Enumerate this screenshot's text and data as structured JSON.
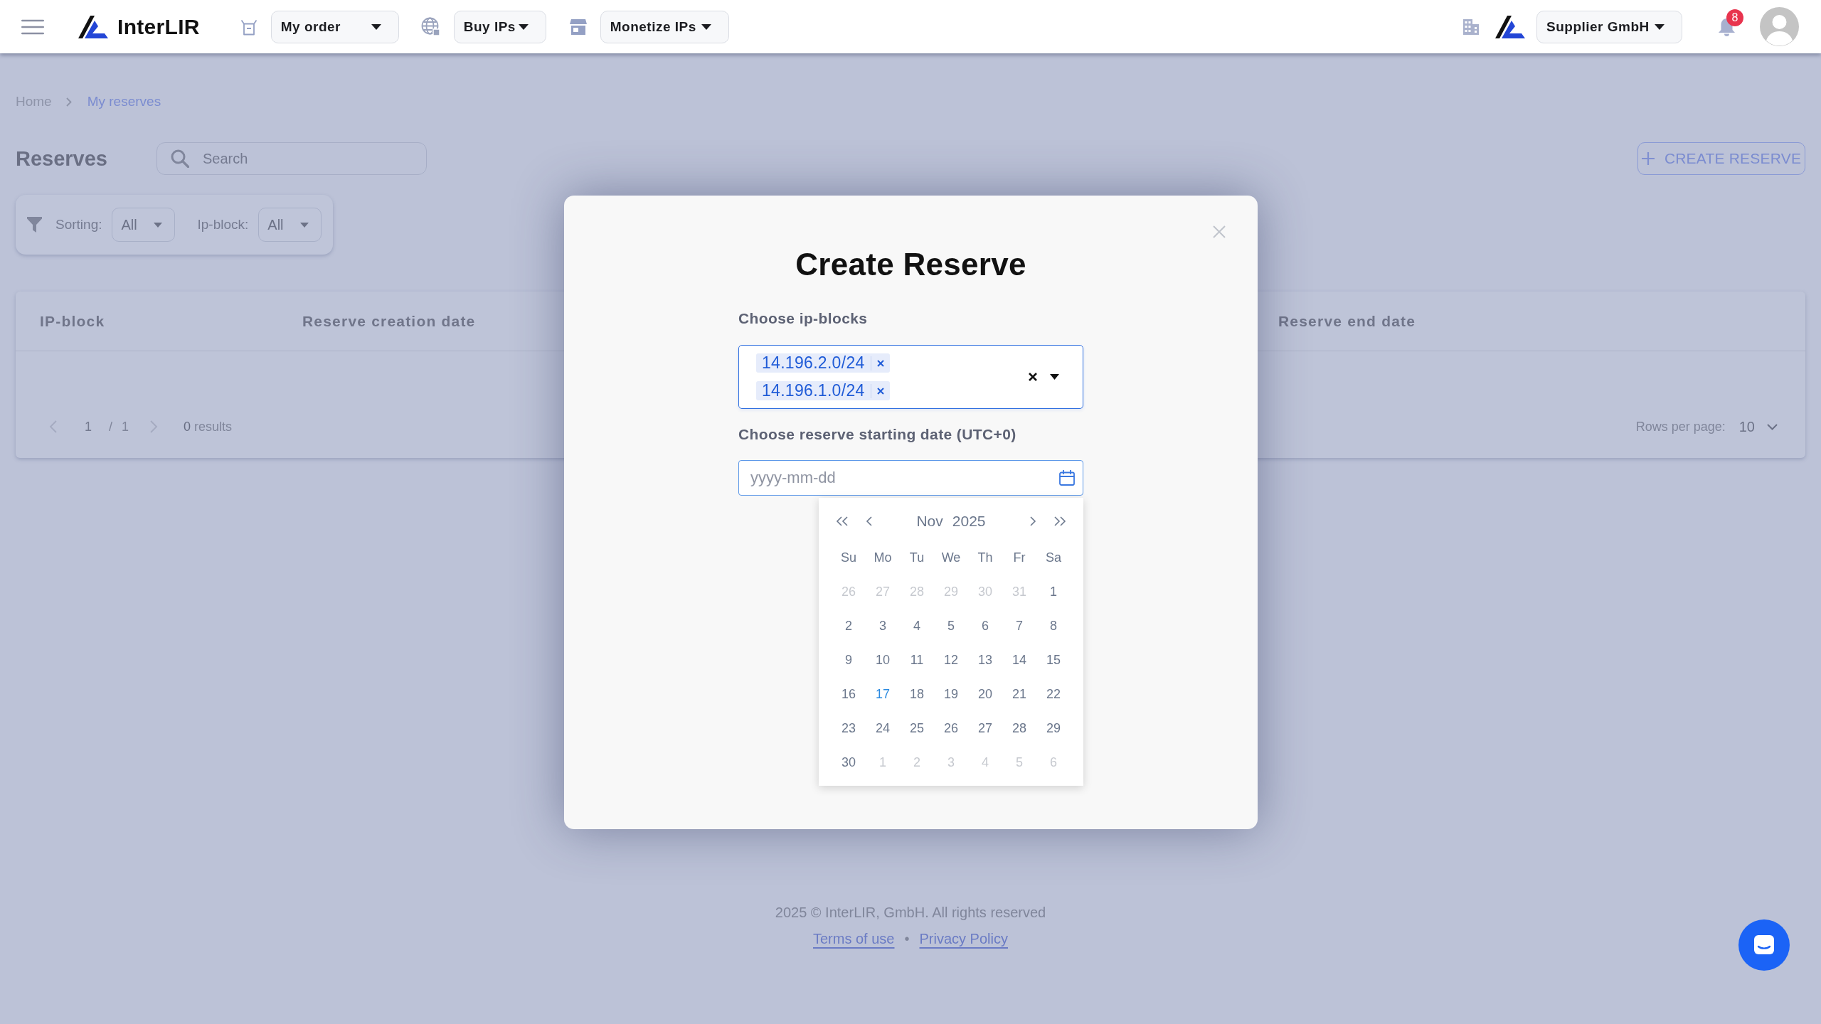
{
  "top_bar": {
    "brand": "InterLIR",
    "nav": [
      {
        "label": "My order"
      },
      {
        "label": "Buy IPs"
      },
      {
        "label": "Monetize IPs"
      }
    ],
    "account": "Supplier GmbH",
    "notification_count": "8"
  },
  "breadcrumb": [
    {
      "label": "Home",
      "current": false
    },
    {
      "label": "My reserves",
      "current": true
    }
  ],
  "page_title": "Reserves",
  "search": {
    "placeholder": "Search"
  },
  "create_button": "CREATE RESERVE",
  "filters": [
    {
      "label": "Sorting:",
      "value": "All"
    },
    {
      "label": "Ip-block:",
      "value": "All"
    }
  ],
  "table": {
    "columns": [
      "IP-block",
      "Reserve creation date",
      "Reserve end date"
    ],
    "pagination": {
      "prev_disabled": true,
      "page": "1",
      "separator": "/",
      "total": "1",
      "next_disabled": true,
      "results": "**0** results"
    },
    "rows_per_page": {
      "label": "Rows per page:",
      "value": "10"
    }
  },
  "modal": {
    "title": "Create Reserve",
    "ip_blocks": {
      "label": "Choose ip-blocks",
      "tags": [
        "14.196.2.0/24",
        "14.196.1.0/24"
      ]
    },
    "start_date": {
      "label": "Choose reserve starting date (UTC+0)",
      "placeholder": "yyyy-mm-dd"
    },
    "calendar": {
      "month": "Nov",
      "year": "2025",
      "weekdays": [
        "Su",
        "Mo",
        "Tu",
        "We",
        "Th",
        "Fr",
        "Sa"
      ],
      "weeks": [
        [
          {
            "day": "26",
            "outside": true,
            "today": false
          },
          {
            "day": "27",
            "outside": true,
            "today": false
          },
          {
            "day": "28",
            "outside": true,
            "today": false
          },
          {
            "day": "29",
            "outside": true,
            "today": false
          },
          {
            "day": "30",
            "outside": true,
            "today": false
          },
          {
            "day": "31",
            "outside": true,
            "today": false
          },
          {
            "day": "1",
            "outside": false,
            "today": false
          }
        ],
        [
          {
            "day": "2",
            "outside": false,
            "today": false
          },
          {
            "day": "3",
            "outside": false,
            "today": false
          },
          {
            "day": "4",
            "outside": false,
            "today": false
          },
          {
            "day": "5",
            "outside": false,
            "today": false
          },
          {
            "day": "6",
            "outside": false,
            "today": false
          },
          {
            "day": "7",
            "outside": false,
            "today": false
          },
          {
            "day": "8",
            "outside": false,
            "today": false
          }
        ],
        [
          {
            "day": "9",
            "outside": false,
            "today": false
          },
          {
            "day": "10",
            "outside": false,
            "today": false
          },
          {
            "day": "11",
            "outside": false,
            "today": false
          },
          {
            "day": "12",
            "outside": false,
            "today": false
          },
          {
            "day": "13",
            "outside": false,
            "today": false
          },
          {
            "day": "14",
            "outside": false,
            "today": false
          },
          {
            "day": "15",
            "outside": false,
            "today": false
          }
        ],
        [
          {
            "day": "16",
            "outside": false,
            "today": false
          },
          {
            "day": "17",
            "outside": false,
            "today": true
          },
          {
            "day": "18",
            "outside": false,
            "today": false
          },
          {
            "day": "19",
            "outside": false,
            "today": false
          },
          {
            "day": "20",
            "outside": false,
            "today": false
          },
          {
            "day": "21",
            "outside": false,
            "today": false
          },
          {
            "day": "22",
            "outside": false,
            "today": false
          }
        ],
        [
          {
            "day": "23",
            "outside": false,
            "today": false
          },
          {
            "day": "24",
            "outside": false,
            "today": false
          },
          {
            "day": "25",
            "outside": false,
            "today": false
          },
          {
            "day": "26",
            "outside": false,
            "today": false
          },
          {
            "day": "27",
            "outside": false,
            "today": false
          },
          {
            "day": "28",
            "outside": false,
            "today": false
          },
          {
            "day": "29",
            "outside": false,
            "today": false
          }
        ],
        [
          {
            "day": "30",
            "outside": false,
            "today": false
          },
          {
            "day": "1",
            "outside": true,
            "today": false
          },
          {
            "day": "2",
            "outside": true,
            "today": false
          },
          {
            "day": "3",
            "outside": true,
            "today": false
          },
          {
            "day": "4",
            "outside": true,
            "today": false
          },
          {
            "day": "5",
            "outside": true,
            "today": false
          },
          {
            "day": "6",
            "outside": true,
            "today": false
          }
        ]
      ]
    }
  },
  "footer": {
    "copyright": "2025 © InterLIR, GmbH. All rights reserved",
    "links": [
      "Terms of use",
      "Privacy Policy"
    ],
    "separator": "•"
  }
}
